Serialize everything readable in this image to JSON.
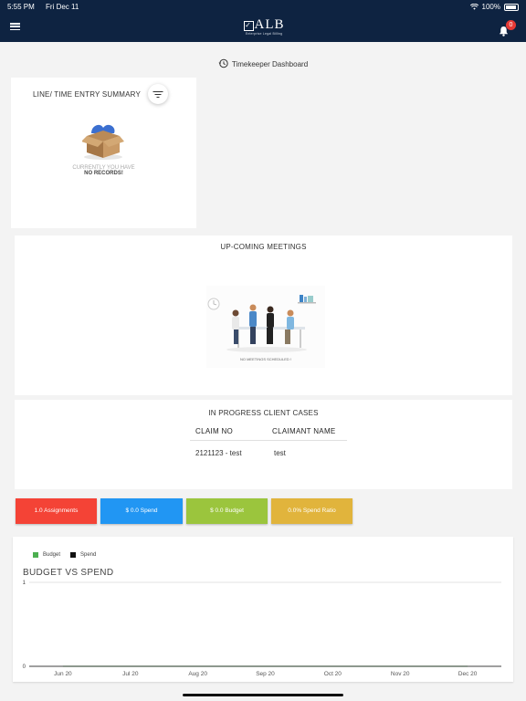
{
  "status_bar": {
    "time": "5:55 PM",
    "date": "Fri Dec 11",
    "battery": "100%"
  },
  "header": {
    "logo_text": "ALB",
    "logo_tagline": "Enterprise Legal Billing",
    "notification_count": "0"
  },
  "page_title": "Timekeeper Dashboard",
  "line_entry_summary": {
    "title": "LINE/ TIME ENTRY SUMMARY",
    "empty_line1": "CURRENTLY YOU HAVE",
    "empty_line2": "NO RECORDS!"
  },
  "meetings": {
    "title": "UP-COMING MEETINGS",
    "empty_text": "NO MEETINGS SCHEDULED !"
  },
  "cases": {
    "title": "IN PROGRESS CLIENT CASES",
    "columns": [
      "CLAIM NO",
      "CLAIMANT NAME"
    ],
    "rows": [
      [
        "2121123 - test",
        "test"
      ]
    ]
  },
  "kpis": [
    {
      "label": "1.0 Assignments",
      "color": "#f44336"
    },
    {
      "label": "$ 0.0 Spend",
      "color": "#2196f3"
    },
    {
      "label": "$ 0.0 Budget",
      "color": "#9bc53d"
    },
    {
      "label": "0.0% Spend Ratio",
      "color": "#e1b43c"
    }
  ],
  "chart_data": {
    "type": "line",
    "title": "BUDGET VS SPEND",
    "categories": [
      "Jun 20",
      "Jul 20",
      "Aug 20",
      "Sep 20",
      "Oct 20",
      "Nov 20",
      "Dec 20"
    ],
    "series": [
      {
        "name": "Budget",
        "color": "#4caf50",
        "values": [
          0,
          0,
          0,
          0,
          0,
          0,
          0
        ]
      },
      {
        "name": "Spend",
        "color": "#111111",
        "values": [
          0,
          0,
          0,
          0,
          0,
          0,
          0
        ]
      }
    ],
    "ylim": [
      0,
      1
    ],
    "yticks": [
      "0",
      "1"
    ],
    "legend": "top-left",
    "grid": true
  }
}
